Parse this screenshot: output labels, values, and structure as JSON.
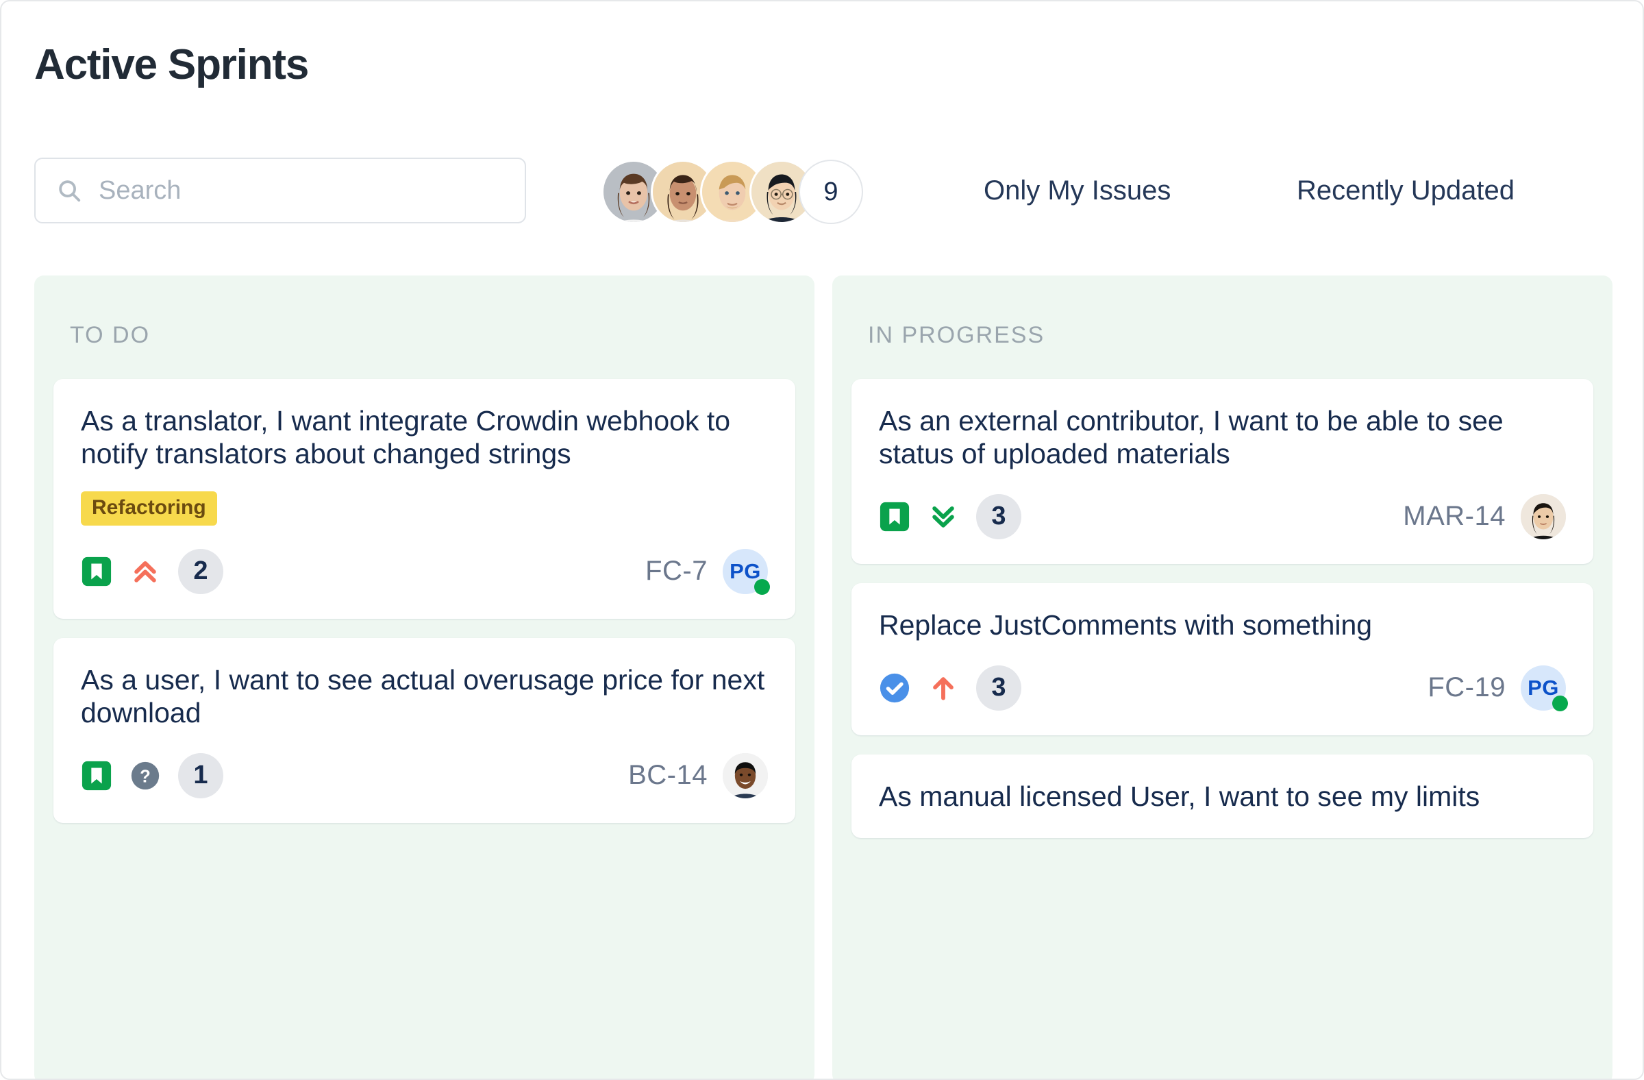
{
  "header": {
    "title": "Active Sprints"
  },
  "search": {
    "placeholder": "Search",
    "value": "",
    "icon": "search-icon"
  },
  "avatars": {
    "shown": 4,
    "more_count": "9",
    "people": [
      {
        "name": "avatar-1",
        "skin": "#e8c3a8",
        "hair": "#5a3a24",
        "bg": "#b9bec4",
        "top": "#f2f2f2"
      },
      {
        "name": "avatar-2",
        "skin": "#c89070",
        "hair": "#3a2417",
        "bg": "#f0d7af",
        "top": "#e9e3dc"
      },
      {
        "name": "avatar-3",
        "skin": "#f0cdb0",
        "hair": "#c99a56",
        "bg": "#f4dcb4",
        "top": "#f3ddc0"
      },
      {
        "name": "avatar-4",
        "skin": "#f2d2b2",
        "hair": "#171a1f",
        "bg": "#f0e0c4",
        "top": "#1d2736"
      }
    ]
  },
  "filters": {
    "only_my_issues": "Only My Issues",
    "recently_updated": "Recently Updated"
  },
  "colors": {
    "column_bg": "#eef7f1",
    "tag_bg": "#f7d94c",
    "tag_text": "#6b4b10",
    "story_icon": "#0aa24c",
    "task_icon": "#4a90e8",
    "priority_high": "#f5705b",
    "priority_low": "#0aa24c",
    "badge_bg": "#e4e6ea",
    "key_text": "#6b778c",
    "title_text": "#212b36",
    "presence": "#06a94d"
  },
  "board": {
    "columns": [
      {
        "id": "todo",
        "title": "TO DO",
        "cards": [
          {
            "title": "As a translator, I want integrate Crowdin webhook to notify translators about changed strings",
            "tag": "Refactoring",
            "type_icon": "story-bookmark-icon",
            "priority_icon": "priority-highest-icon",
            "count": "2",
            "key": "FC-7",
            "assignee_kind": "initials",
            "assignee_initials": "PG",
            "presence": true
          },
          {
            "title": "As a user, I want to see actual overusage price for next download",
            "tag": null,
            "type_icon": "story-bookmark-icon",
            "priority_icon": "priority-unknown-icon",
            "count": "1",
            "key": "BC-14",
            "assignee_kind": "photo",
            "assignee_skin": "#7a4a2b",
            "assignee_hair": "#10100f",
            "assignee_bg": "#f2f2f2",
            "assignee_top": "#2a3a52",
            "presence": false
          }
        ]
      },
      {
        "id": "inprogress",
        "title": "IN PROGRESS",
        "cards": [
          {
            "title": "As an external contributor, I want to be able to see status of uploaded materials",
            "tag": null,
            "type_icon": "story-bookmark-icon",
            "priority_icon": "priority-lowest-icon",
            "count": "3",
            "key": "MAR-14",
            "assignee_kind": "photo",
            "assignee_skin": "#eccba8",
            "assignee_hair": "#19140f",
            "assignee_bg": "#efe7dd",
            "assignee_top": "#151515",
            "presence": false
          },
          {
            "title": "Replace JustComments with something",
            "tag": null,
            "type_icon": "task-check-icon",
            "priority_icon": "priority-high-icon",
            "count": "3",
            "key": "FC-19",
            "assignee_kind": "initials",
            "assignee_initials": "PG",
            "presence": true
          },
          {
            "title": "As manual licensed User, I want to see my limits",
            "tag": null,
            "type_icon": null,
            "priority_icon": null,
            "count": null,
            "key": null,
            "assignee_kind": null,
            "presence": false
          }
        ]
      }
    ]
  }
}
